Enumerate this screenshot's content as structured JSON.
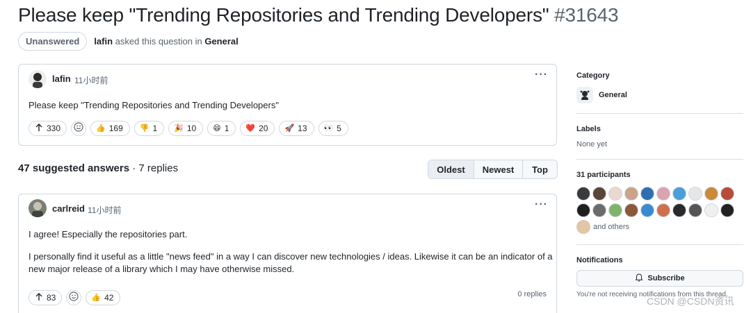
{
  "header": {
    "title": "Please keep \"Trending Repositories and Trending Developers\"",
    "number": "#31643",
    "state": "Unanswered",
    "author": "lafin",
    "asked_text": "asked this question in",
    "category": "General"
  },
  "post": {
    "author": "lafin",
    "time": "11小时前",
    "body": "Please keep \"Trending Repositories and Trending Developers\"",
    "more": "···",
    "upvotes": "330",
    "reactions": [
      {
        "emoji": "👍",
        "count": "169"
      },
      {
        "emoji": "👎",
        "count": "1"
      },
      {
        "emoji": "🎉",
        "count": "10"
      },
      {
        "emoji": "😄",
        "count": "1"
      },
      {
        "emoji": "❤️",
        "count": "20"
      },
      {
        "emoji": "🚀",
        "count": "13"
      },
      {
        "emoji": "👀",
        "count": "5"
      }
    ]
  },
  "answers": {
    "count_label": "47 suggested answers",
    "replies_label": " · 7 replies",
    "sort": [
      "Oldest",
      "Newest",
      "Top"
    ]
  },
  "answer1": {
    "author": "carlreid",
    "time": "11小时前",
    "more": "···",
    "para1": "I agree! Especially the repositories part.",
    "para2_line1": "I personally find it useful as a little \"news feed\" in a way I can discover new technologies / ideas. Likewise it can be an indicator of a",
    "para2_line2": "new major release of a library which I may have otherwise missed.",
    "upvotes": "83",
    "reactions": [
      {
        "emoji": "👍",
        "count": "42"
      }
    ],
    "replies": "0 replies"
  },
  "sidebar": {
    "category_label": "Category",
    "category": "General",
    "labels_label": "Labels",
    "labels_value": "None yet",
    "participants_label": "31 participants",
    "and_others": "and others",
    "notifications_label": "Notifications",
    "subscribe": "Subscribe",
    "notify_note": "You're not receiving notifications from this thread."
  },
  "watermark": "CSDN @CSDN资讯",
  "colors": {
    "border": "#d0d7de",
    "muted": "#59636e",
    "text": "#1f2328"
  },
  "participant_avatars": [
    "#3b3b3b",
    "#5a4636",
    "#e8d9d0",
    "#c9a48a",
    "#2f6fb0",
    "#d9a3b0",
    "#4a9fd8",
    "#e6e6e6",
    "#c98a3a",
    "#b84b3a",
    "#1f1f1f",
    "#6b6b6b",
    "#7fb36a",
    "#8a5a3a",
    "#3a8ad0",
    "#d0704a",
    "#2a2a2a",
    "#555555",
    "#f0f0f0",
    "#222222"
  ]
}
